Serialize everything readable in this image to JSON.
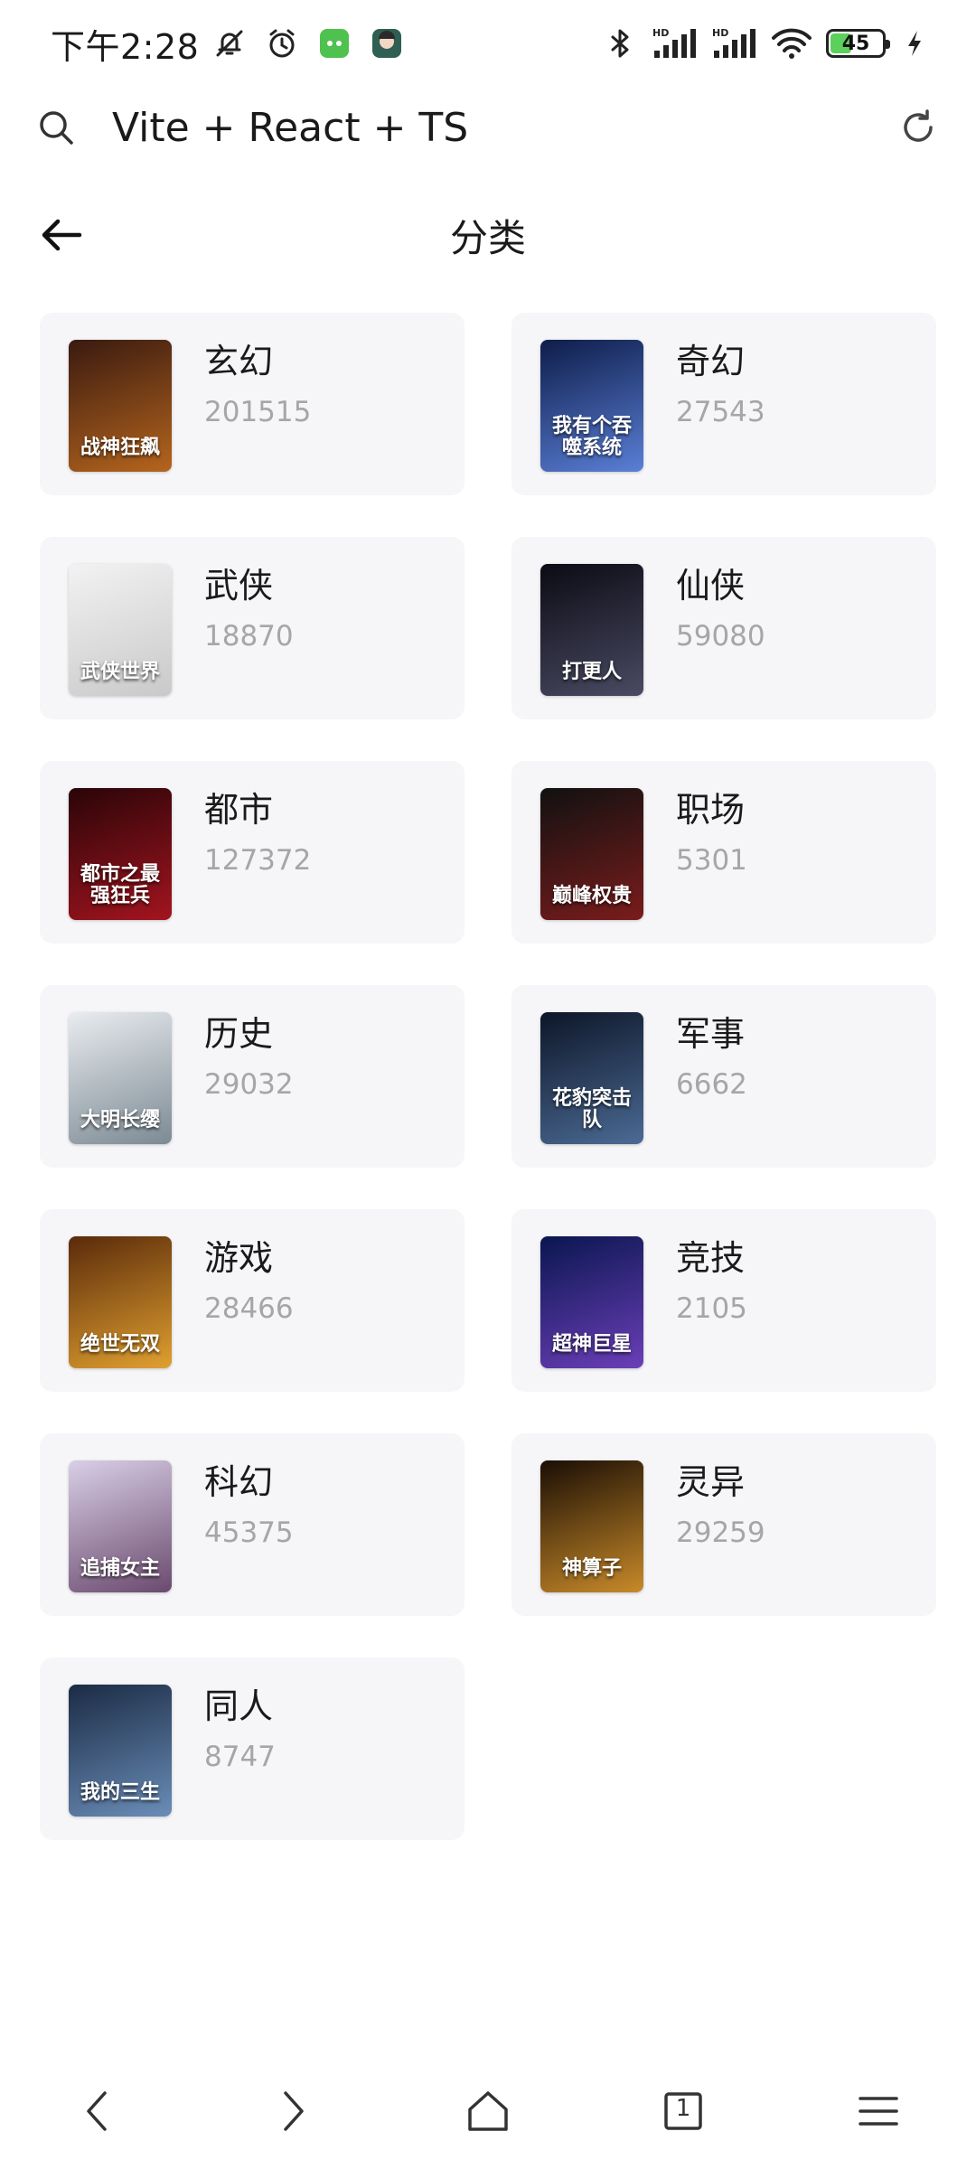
{
  "status_bar": {
    "time": "下午2:28",
    "battery": "45",
    "icons": [
      "bell-off-icon",
      "alarm-icon",
      "app-notification-icon",
      "avatar-notification-icon",
      "bluetooth-icon",
      "signal-hd-icon",
      "signal-hd-icon",
      "wifi-icon",
      "battery-icon",
      "charging-icon"
    ]
  },
  "browser": {
    "url": "Vite + React + TS",
    "icons": [
      "search-icon",
      "reload-icon"
    ]
  },
  "header": {
    "title": "分类"
  },
  "categories": [
    {
      "name": "玄幻",
      "count": "201515",
      "cover_text": "战神狂飙",
      "cover_colors": [
        "#3a1a10",
        "#b5651d"
      ]
    },
    {
      "name": "奇幻",
      "count": "27543",
      "cover_text": "我有个吞噬系统",
      "cover_colors": [
        "#0e1d4a",
        "#5a7fd6"
      ]
    },
    {
      "name": "武侠",
      "count": "18870",
      "cover_text": "武侠世界",
      "cover_colors": [
        "#f2f2f2",
        "#c9c9c9"
      ]
    },
    {
      "name": "仙侠",
      "count": "59080",
      "cover_text": "打更人",
      "cover_colors": [
        "#0b0b14",
        "#4a4a63"
      ]
    },
    {
      "name": "都市",
      "count": "127372",
      "cover_text": "都市之最强狂兵",
      "cover_colors": [
        "#2a0508",
        "#a3141f"
      ]
    },
    {
      "name": "职场",
      "count": "5301",
      "cover_text": "巅峰权贵",
      "cover_colors": [
        "#111111",
        "#7a1c1c"
      ]
    },
    {
      "name": "历史",
      "count": "29032",
      "cover_text": "大明长缨",
      "cover_colors": [
        "#e9ecef",
        "#7c8a94"
      ]
    },
    {
      "name": "军事",
      "count": "6662",
      "cover_text": "花豹突击队",
      "cover_colors": [
        "#0d1628",
        "#4b6a94"
      ]
    },
    {
      "name": "游戏",
      "count": "28466",
      "cover_text": "绝世无双",
      "cover_colors": [
        "#5a2a0a",
        "#e0a030"
      ]
    },
    {
      "name": "竞技",
      "count": "2105",
      "cover_text": "超神巨星",
      "cover_colors": [
        "#0a1650",
        "#6b3fb8"
      ]
    },
    {
      "name": "科幻",
      "count": "45375",
      "cover_text": "追捕女主",
      "cover_colors": [
        "#d9cfe6",
        "#6a4a6e"
      ]
    },
    {
      "name": "灵异",
      "count": "29259",
      "cover_text": "神算子",
      "cover_colors": [
        "#1a0e04",
        "#c88a2a"
      ]
    },
    {
      "name": "同人",
      "count": "8747",
      "cover_text": "我的三生",
      "cover_colors": [
        "#1b2b44",
        "#6a8db8"
      ]
    }
  ],
  "bottom_nav": {
    "icons": [
      "back-icon",
      "forward-icon",
      "home-icon",
      "tabs-icon",
      "menu-icon"
    ],
    "tabs_count": "1"
  }
}
